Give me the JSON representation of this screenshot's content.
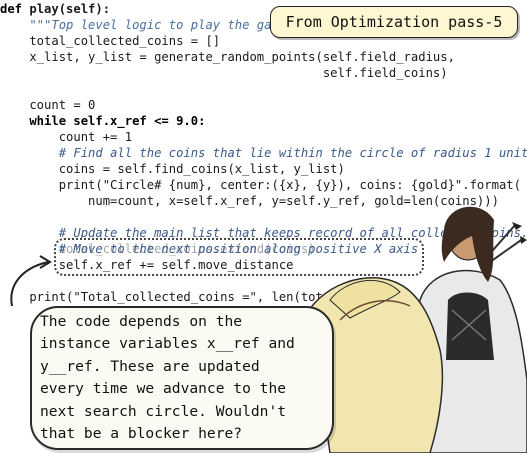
{
  "badge": {
    "text": "From Optimization pass-5"
  },
  "code": {
    "lines": [
      "def play(self):",
      "    \"\"\"Top level logic to play the ga",
      "    total_collected_coins = []",
      "    x_list, y_list = generate_random_points(self.field_radius,",
      "                                            self.field_coins)",
      "",
      "    count = 0",
      "    while self.x_ref <= 9.0:",
      "        count += 1",
      "        # Find all the coins that lie within the circle of radius 1 unit",
      "        coins = self.find_coins(x_list, y_list)",
      "        print(\"Circle# {num}, center:({x}, {y}), coins: {gold}\".format(",
      "            num=count, x=self.x_ref, y=self.y_ref, gold=len(coins)))",
      "",
      "        # Update the main list that keeps record of all collected coins.",
      "        total_collected_coins.extend(coins)",
      "",
      "        # Move to the next position along positive X axis",
      "        self.x_ref += self.move_distance",
      "",
      "    print(\"Total_collected_coins =\", len(total_colle"
    ]
  },
  "speech": {
    "text": "The code depends on the\ninstance variables x__ref and\ny__ref. These are updated\nevery time we advance to the\nnext search circle. Wouldn't\nthat be a blocker here?"
  },
  "illustration": {
    "subject": "knight-archer-on-horse",
    "colors": {
      "skin": "#c99a72",
      "hair": "#3a2a20",
      "horse": "#f2e6b0",
      "coat": "#e9e9e9",
      "dark": "#2b2b2b"
    }
  }
}
